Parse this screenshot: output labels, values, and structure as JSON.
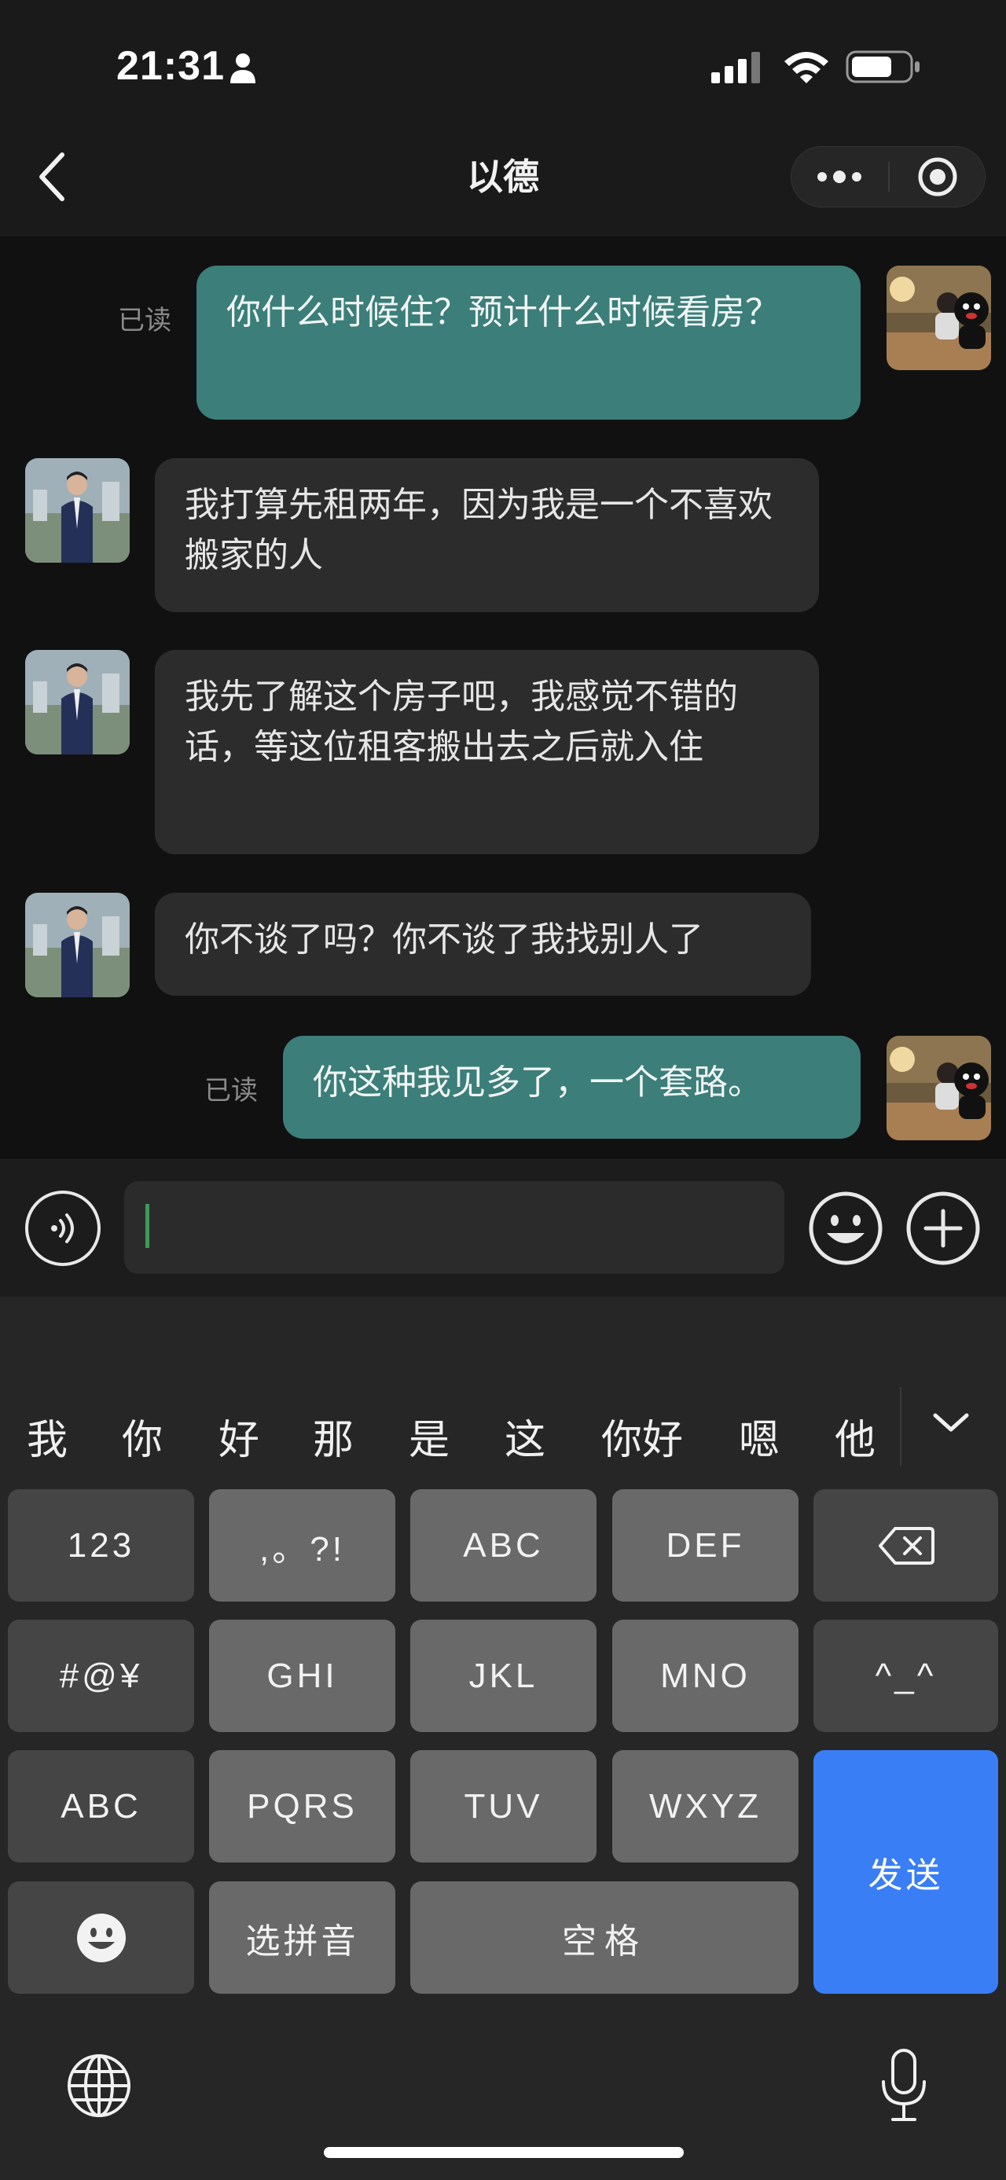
{
  "status_bar": {
    "time": "21:31"
  },
  "header": {
    "title": "以德"
  },
  "messages": [
    {
      "side": "out",
      "text": "你什么时候住？预计什么时候看房？",
      "read_label": "已读"
    },
    {
      "side": "in",
      "text": "我打算先租两年，因为我是一个不喜欢搬家的人"
    },
    {
      "side": "in",
      "text": "我先了解这个房子吧，我感觉不错的话，等这位租客搬出去之后就入住"
    },
    {
      "side": "in",
      "text": "你不谈了吗？你不谈了我找别人了"
    },
    {
      "side": "out",
      "text": "你这种我见多了，一个套路。",
      "read_label": "已读"
    }
  ],
  "input": {
    "value": ""
  },
  "keyboard": {
    "candidates": [
      "我",
      "你",
      "好",
      "那",
      "是",
      "这",
      "你好",
      "嗯",
      "他"
    ],
    "keys": {
      "num": "123",
      "punct": ",。?!",
      "abc": "ABC",
      "def": "DEF",
      "symbols": "#@¥",
      "ghi": "GHI",
      "jkl": "JKL",
      "mno": "MNO",
      "emoticon": "^_^",
      "abc_switch": "ABC",
      "pqrs": "PQRS",
      "tuv": "TUV",
      "wxyz": "WXYZ",
      "pinyin": "选拼音",
      "space": "空格",
      "send": "发送"
    }
  },
  "colors": {
    "outgoing_bubble": "#3c7e79",
    "incoming_bubble": "#2c2c2c",
    "send_key": "#3a7ef6"
  },
  "icons": [
    "person-icon",
    "signal-icon",
    "wifi-icon",
    "battery-icon",
    "back-icon",
    "more-icon",
    "close-target-icon",
    "voice-icon",
    "emoji-icon",
    "plus-icon",
    "chevron-down-icon",
    "backspace-icon",
    "smiley-icon",
    "globe-icon",
    "mic-icon"
  ]
}
